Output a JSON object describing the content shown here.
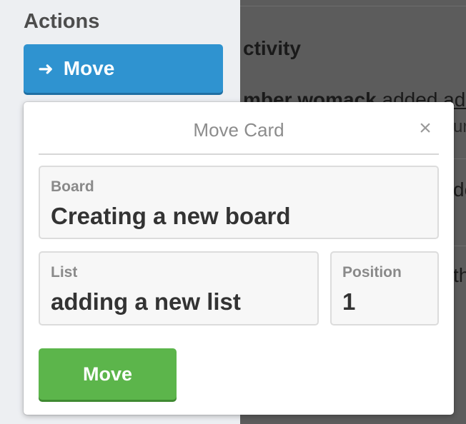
{
  "sidebar": {
    "heading": "Actions",
    "move_button": {
      "icon": "arrow-right-icon",
      "label": "Move"
    }
  },
  "background": {
    "activity_heading": "ctivity",
    "entry_name": "mber womack",
    "entry_text": " added ",
    "entry_link": "ade",
    "entry_sub": "ur",
    "fragment_2": "de",
    "fragment_3": "th"
  },
  "move_card": {
    "title": "Move Card",
    "close_icon": "close-icon",
    "board": {
      "label": "Board",
      "value": "Creating a new board"
    },
    "list": {
      "label": "List",
      "value": "adding a new list"
    },
    "position": {
      "label": "Position",
      "value": "1"
    },
    "submit_label": "Move"
  },
  "colors": {
    "primary_blue": "#2f93d0",
    "success_green": "#5cb54b",
    "overlay": "#5c5c5c",
    "sidebar_bg": "#edeff2"
  }
}
